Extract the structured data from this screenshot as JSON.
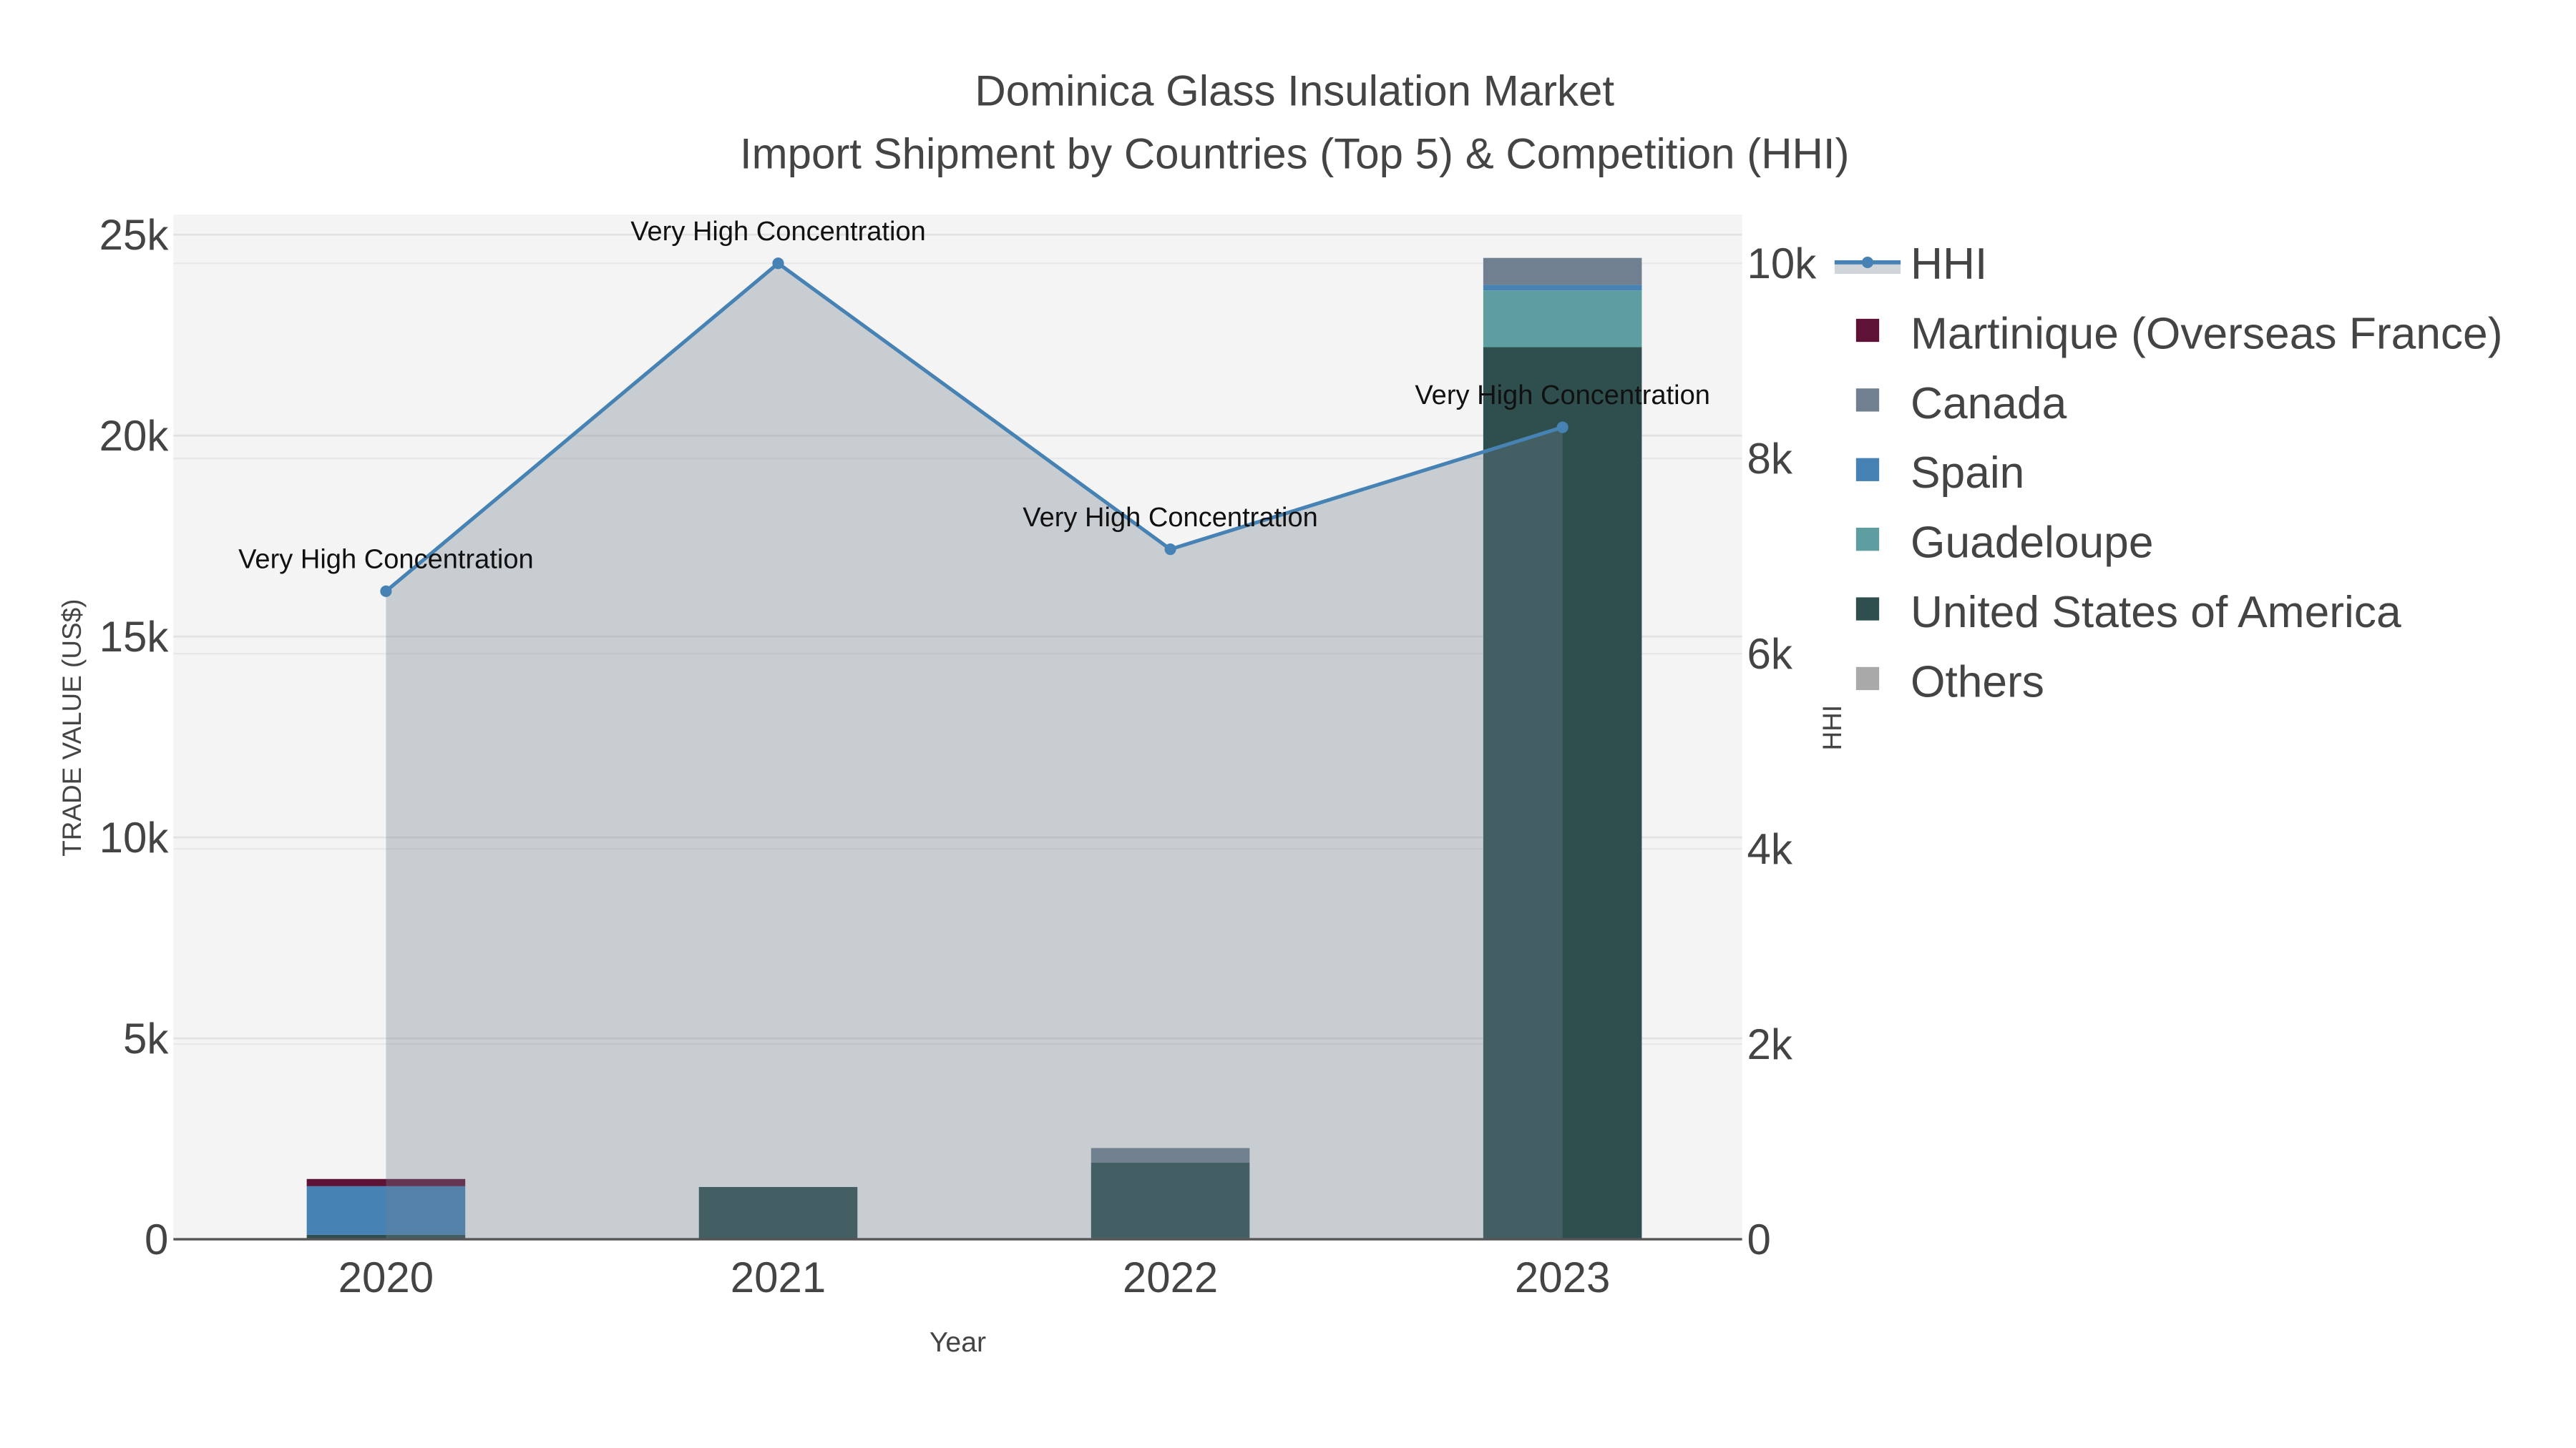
{
  "chart_data": {
    "type": "bar",
    "title_line1": "Dominica Glass Insulation Market",
    "title_line2": "Import Shipment by Countries (Top 5) & Competition (HHI)",
    "xlabel": "Year",
    "ylabel": "TRADE VALUE (US$)",
    "y2label": "HHI",
    "categories": [
      "2020",
      "2021",
      "2022",
      "2023"
    ],
    "ylim": [
      0,
      25500
    ],
    "y2lim": [
      0,
      10500
    ],
    "yticks": [
      {
        "v": 0,
        "label": "0"
      },
      {
        "v": 5000,
        "label": "5k"
      },
      {
        "v": 10000,
        "label": "10k"
      },
      {
        "v": 15000,
        "label": "15k"
      },
      {
        "v": 20000,
        "label": "20k"
      },
      {
        "v": 25000,
        "label": "25k"
      }
    ],
    "y2ticks": [
      {
        "v": 0,
        "label": "0"
      },
      {
        "v": 2000,
        "label": "2k"
      },
      {
        "v": 4000,
        "label": "4k"
      },
      {
        "v": 6000,
        "label": "6k"
      },
      {
        "v": 8000,
        "label": "8k"
      },
      {
        "v": 10000,
        "label": "10k"
      }
    ],
    "series": [
      {
        "name": "Others",
        "color": "#A9A9A9",
        "values": [
          0,
          0,
          30,
          0
        ]
      },
      {
        "name": "United States of America",
        "color": "#2F4F4F",
        "values": [
          110,
          1300,
          1880,
          22200
        ]
      },
      {
        "name": "Guadeloupe",
        "color": "#5F9EA0",
        "values": [
          0,
          0,
          0,
          1410
        ]
      },
      {
        "name": "Spain",
        "color": "#4682B4",
        "values": [
          1210,
          0,
          0,
          140
        ]
      },
      {
        "name": "Canada",
        "color": "#708090",
        "values": [
          0,
          0,
          360,
          670
        ]
      },
      {
        "name": "Martinique (Overseas France)",
        "color": "#5E1336",
        "values": [
          180,
          0,
          0,
          0
        ]
      }
    ],
    "hhi": {
      "name": "HHI",
      "color": "#4682B4",
      "values": [
        6640,
        10000,
        7070,
        8320
      ],
      "annotations": [
        "Very High Concentration",
        "Very High Concentration",
        "Very High Concentration",
        "Very High Concentration"
      ]
    },
    "legend_order": [
      "HHI",
      "Martinique (Overseas France)",
      "Canada",
      "Spain",
      "Guadeloupe",
      "United States of America",
      "Others"
    ],
    "legend_position": "right",
    "grid": true
  }
}
